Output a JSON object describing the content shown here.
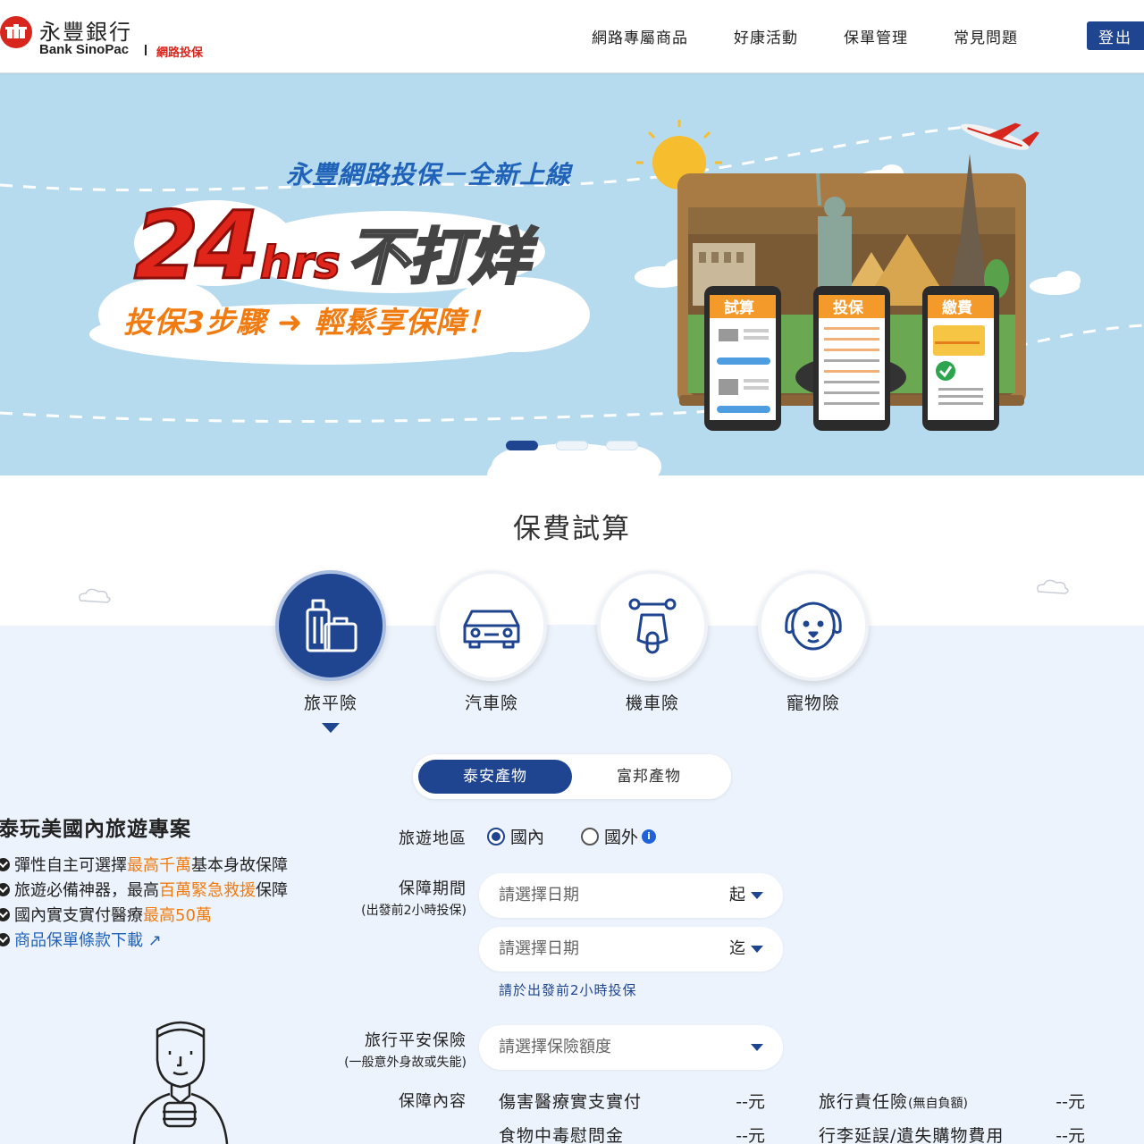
{
  "header": {
    "logo_cn": "永豐銀行",
    "logo_en": "Bank SinoPac",
    "logo_sub": "網路投保",
    "nav": [
      "網路專屬商品",
      "好康活動",
      "保單管理",
      "常見問題"
    ],
    "logout_label": "登出"
  },
  "banner": {
    "tagline": "永豐網路投保－全新上線",
    "headline_num": "24",
    "headline_hrs": "hrs",
    "headline_no": "不打烊",
    "subline": "投保3步驟 ➜ 輕鬆享保障！",
    "phone_labels": [
      "試算",
      "投保",
      "繳費"
    ],
    "slide_count": 3,
    "active_slide": 1
  },
  "calculator": {
    "title": "保費試算",
    "categories": [
      {
        "label": "旅平險",
        "icon": "luggage-icon",
        "active": true
      },
      {
        "label": "汽車險",
        "icon": "car-icon",
        "active": false
      },
      {
        "label": "機車險",
        "icon": "scooter-icon",
        "active": false
      },
      {
        "label": "寵物險",
        "icon": "dog-icon",
        "active": false
      }
    ],
    "insurers": [
      "泰安產物",
      "富邦產物"
    ],
    "active_insurer": "泰安產物"
  },
  "plan": {
    "title": "泰玩美國內旅遊專案",
    "features": [
      {
        "pre": "彈性自主可選擇",
        "hl": "最高千萬",
        "post": "基本身故保障"
      },
      {
        "pre": "旅遊必備神器，最高",
        "hl": "百萬緊急救援",
        "post": "保障"
      },
      {
        "pre": "國內實支實付醫療",
        "hl": "最高50萬",
        "post": ""
      }
    ],
    "download_link": "商品保單條款下載"
  },
  "form": {
    "region_label": "旅遊地區",
    "region_options": [
      "國內",
      "國外"
    ],
    "region_selected": "國內",
    "period_label": "保障期間",
    "period_note": "(出發前2小時投保)",
    "date_placeholder": "請選擇日期",
    "start_tag": "起",
    "end_tag": "迄",
    "period_hint": "請於出發前2小時投保",
    "amount_label": "旅行平安保險",
    "amount_note": "(一般意外身故或失能)",
    "amount_placeholder": "請選擇保險額度",
    "coverage_label": "保障內容",
    "coverage": [
      {
        "name": "傷害醫療實支實付",
        "note": "",
        "value": "--元"
      },
      {
        "name": "旅行責任險",
        "note": "(無自負額)",
        "value": "--元"
      },
      {
        "name": "食物中毒慰問金",
        "note": "",
        "value": "--元"
      },
      {
        "name": "行李延誤/遺失購物費用",
        "note": "",
        "value": "--元"
      }
    ]
  },
  "colors": {
    "brand_red": "#d7261e",
    "primary_blue": "#1f4591",
    "highlight_orange": "#f07b10",
    "banner_sky": "#b7dbee"
  }
}
